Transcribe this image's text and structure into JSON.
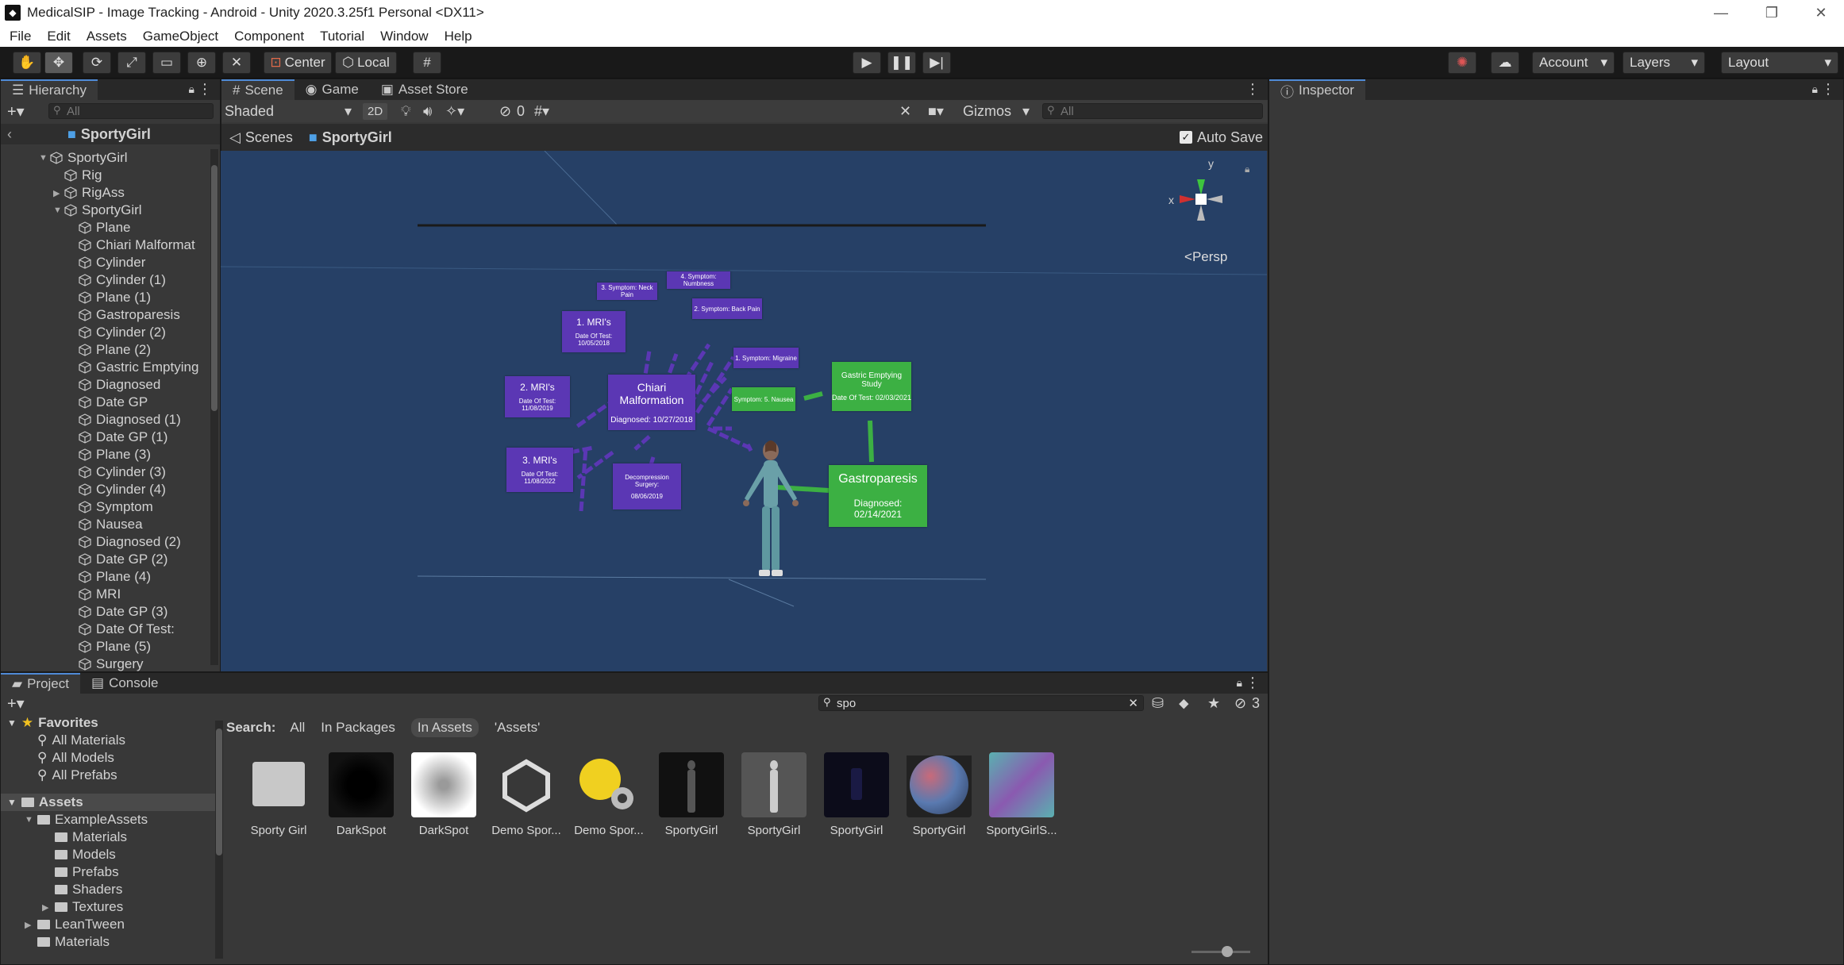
{
  "window": {
    "title": "MedicalSIP - Image Tracking - Android - Unity 2020.3.25f1 Personal <DX11>",
    "minimize": "—",
    "restore": "❐",
    "close": "✕"
  },
  "menu": [
    "File",
    "Edit",
    "Assets",
    "GameObject",
    "Component",
    "Tutorial",
    "Window",
    "Help"
  ],
  "toolbar": {
    "pivot": "Center",
    "space": "Local",
    "account": "Account",
    "layers": "Layers",
    "layout": "Layout"
  },
  "hierarchy": {
    "tab": "Hierarchy",
    "search_placeholder": "All",
    "breadcrumb": "SportyGirl",
    "items": [
      {
        "label": "SportyGirl",
        "indent": 0,
        "arrow": "down"
      },
      {
        "label": "Rig",
        "indent": 1,
        "arrow": ""
      },
      {
        "label": "RigAss",
        "indent": 1,
        "arrow": "right"
      },
      {
        "label": "SportyGirl",
        "indent": 1,
        "arrow": "down"
      },
      {
        "label": "Plane",
        "indent": 2,
        "arrow": ""
      },
      {
        "label": "Chiari Malformat",
        "indent": 2,
        "arrow": ""
      },
      {
        "label": "Cylinder",
        "indent": 2,
        "arrow": ""
      },
      {
        "label": "Cylinder (1)",
        "indent": 2,
        "arrow": ""
      },
      {
        "label": "Plane (1)",
        "indent": 2,
        "arrow": ""
      },
      {
        "label": "Gastroparesis",
        "indent": 2,
        "arrow": ""
      },
      {
        "label": "Cylinder (2)",
        "indent": 2,
        "arrow": ""
      },
      {
        "label": "Plane (2)",
        "indent": 2,
        "arrow": ""
      },
      {
        "label": "Gastric Emptying",
        "indent": 2,
        "arrow": ""
      },
      {
        "label": "Diagnosed",
        "indent": 2,
        "arrow": ""
      },
      {
        "label": "Date GP",
        "indent": 2,
        "arrow": ""
      },
      {
        "label": "Diagnosed (1)",
        "indent": 2,
        "arrow": ""
      },
      {
        "label": "Date GP (1)",
        "indent": 2,
        "arrow": ""
      },
      {
        "label": "Plane (3)",
        "indent": 2,
        "arrow": ""
      },
      {
        "label": "Cylinder (3)",
        "indent": 2,
        "arrow": ""
      },
      {
        "label": "Cylinder (4)",
        "indent": 2,
        "arrow": ""
      },
      {
        "label": "Symptom",
        "indent": 2,
        "arrow": ""
      },
      {
        "label": "Nausea",
        "indent": 2,
        "arrow": ""
      },
      {
        "label": "Diagnosed (2)",
        "indent": 2,
        "arrow": ""
      },
      {
        "label": "Date GP (2)",
        "indent": 2,
        "arrow": ""
      },
      {
        "label": "Plane (4)",
        "indent": 2,
        "arrow": ""
      },
      {
        "label": "MRI",
        "indent": 2,
        "arrow": ""
      },
      {
        "label": "Date GP (3)",
        "indent": 2,
        "arrow": ""
      },
      {
        "label": "Date Of Test:",
        "indent": 2,
        "arrow": ""
      },
      {
        "label": "Plane (5)",
        "indent": 2,
        "arrow": ""
      },
      {
        "label": "Surgery",
        "indent": 2,
        "arrow": ""
      }
    ]
  },
  "sceneTabs": {
    "scene": "Scene",
    "game": "Game",
    "store": "Asset Store"
  },
  "sceneBar": {
    "shading": "Shaded",
    "mode2d": "2D",
    "hidden_count": "0",
    "gizmos": "Gizmos",
    "search_placeholder": "All"
  },
  "sceneBreadcrumb": {
    "scenes": "Scenes",
    "object": "SportyGirl",
    "autosave": "Auto Save"
  },
  "gizmo": {
    "x": "x",
    "y": "y",
    "persp": "Persp"
  },
  "cards": {
    "chiari_title": "Chiari Malformation",
    "chiari_diag": "Diagnosed: 10/27/2018",
    "mri1_title": "1. MRI's",
    "mri1_date": "Date Of Test: 10/05/2018",
    "mri2_title": "2. MRI's",
    "mri2_date": "Date Of Test: 11/08/2019",
    "mri3_title": "3. MRI's",
    "mri3_date": "Date Of Test: 11/08/2022",
    "surgery_title": "Decompression Surgery:",
    "surgery_date": "08/06/2019",
    "sym_neck": "3. Symptom: Neck Pain",
    "sym_numb": "4. Symptom: Numbness",
    "sym_back": "2. Symptom: Back Pain",
    "sym_migraine": "1. Symptom: Migraine",
    "sym_nausea": "Symptom: 5. Nausea",
    "gastric_title": "Gastric Emptying Study",
    "gastric_date": "Date Of Test: 02/03/2021",
    "gastro_title": "Gastroparesis",
    "gastro_diag": "Diagnosed: 02/14/2021"
  },
  "inspector": {
    "tab": "Inspector"
  },
  "project": {
    "tab": "Project",
    "console": "Console",
    "search_value": "spo",
    "hidden_count": "3",
    "search_label": "Search:",
    "filters": [
      "All",
      "In Packages",
      "In Assets",
      "'Assets'"
    ],
    "favorites": "Favorites",
    "fav_items": [
      "All Materials",
      "All Models",
      "All Prefabs"
    ],
    "assets_root": "Assets",
    "tree": [
      {
        "label": "ExampleAssets",
        "indent": 1,
        "arrow": "down"
      },
      {
        "label": "Materials",
        "indent": 2,
        "arrow": ""
      },
      {
        "label": "Models",
        "indent": 2,
        "arrow": ""
      },
      {
        "label": "Prefabs",
        "indent": 2,
        "arrow": ""
      },
      {
        "label": "Shaders",
        "indent": 2,
        "arrow": ""
      },
      {
        "label": "Textures",
        "indent": 2,
        "arrow": "right"
      },
      {
        "label": "LeanTween",
        "indent": 1,
        "arrow": "right"
      },
      {
        "label": "Materials",
        "indent": 1,
        "arrow": ""
      }
    ],
    "assets": [
      {
        "label": "Sporty Girl",
        "thumb": "folder"
      },
      {
        "label": "DarkSpot",
        "thumb": "dark"
      },
      {
        "label": "DarkSpot",
        "thumb": "blur"
      },
      {
        "label": "Demo Spor...",
        "thumb": "unity"
      },
      {
        "label": "Demo Spor...",
        "thumb": "script"
      },
      {
        "label": "SportyGirl",
        "thumb": "figure-dark"
      },
      {
        "label": "SportyGirl",
        "thumb": "figure-light"
      },
      {
        "label": "SportyGirl",
        "thumb": "figure-navy"
      },
      {
        "label": "SportyGirl",
        "thumb": "sphere"
      },
      {
        "label": "SportyGirlS...",
        "thumb": "texture"
      }
    ]
  },
  "colors": {
    "accent": "#4f8ad6",
    "purple_card": "#5b37b4",
    "green_card": "#3cb043",
    "scene_bg": "#264066"
  }
}
